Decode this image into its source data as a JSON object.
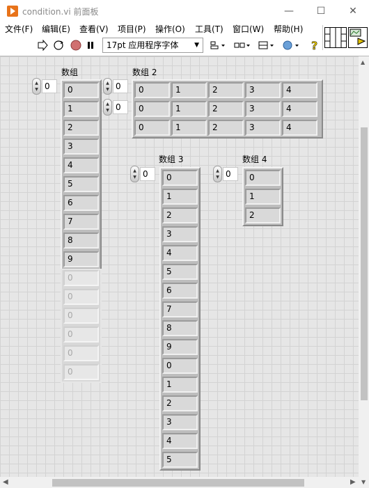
{
  "window": {
    "title": "condition.vi 前面板"
  },
  "window_controls": {
    "minimize": "—",
    "maximize": "☐",
    "close": "✕"
  },
  "menu": [
    "文件(F)",
    "编辑(E)",
    "查看(V)",
    "项目(P)",
    "操作(O)",
    "工具(T)",
    "窗口(W)",
    "帮助(H)"
  ],
  "toolbar": {
    "font": "17pt 应用程序字体"
  },
  "arrays": {
    "array1": {
      "label": "数组",
      "index": "0",
      "values": [
        "0",
        "1",
        "2",
        "3",
        "4",
        "5",
        "6",
        "7",
        "8",
        "9"
      ],
      "ghost_values": [
        "0",
        "0",
        "0",
        "0",
        "0",
        "0"
      ]
    },
    "array2": {
      "label": "数组 2",
      "index_row": "0",
      "index_col": "0",
      "rows": [
        [
          "0",
          "1",
          "2",
          "3",
          "4"
        ],
        [
          "0",
          "1",
          "2",
          "3",
          "4"
        ],
        [
          "0",
          "1",
          "2",
          "3",
          "4"
        ]
      ]
    },
    "array3": {
      "label": "数组 3",
      "index": "0",
      "values": [
        "0",
        "1",
        "2",
        "3",
        "4",
        "5",
        "6",
        "7",
        "8",
        "9",
        "0",
        "1",
        "2",
        "3",
        "4",
        "5"
      ]
    },
    "array4": {
      "label": "数组 4",
      "index": "0",
      "values": [
        "0",
        "1",
        "2"
      ]
    }
  }
}
